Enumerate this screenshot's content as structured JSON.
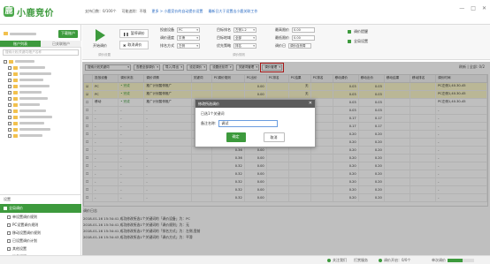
{
  "app": {
    "title": "小鹿竞价"
  },
  "header": {
    "meta_items": [
      "支持日数：0/100个",
      "可能追踪：不限"
    ],
    "links": [
      "更多 > 小鹿竞价的自动提价设置",
      "最新日大于设置出小鹿关联工作"
    ],
    "window_controls": [
      "—",
      "□",
      "✕"
    ]
  },
  "sidebar": {
    "download_button": "下载账户",
    "tabs": [
      "账户列表",
      "已关联账户"
    ],
    "search_placeholder": "搜索计划/关键词/账户名称",
    "tree_count": 13,
    "settings_title": "设置",
    "active_item": "全局调价",
    "items": [
      "单设置调价规则",
      "PC设置调价规则",
      "移动设置调价规则",
      "已设置调价计划",
      "其他设置",
      "消息提醒"
    ]
  },
  "toolbar": {
    "start_label": "开始调价",
    "pause_label": "暂停调价",
    "reset_label": "取消调价",
    "group_labels": [
      "调价设置",
      "调价规则"
    ],
    "fields_col1": [
      {
        "label": "投放设备",
        "value": "PC"
      },
      {
        "label": "调价速度",
        "value": "平滑"
      },
      {
        "label": "排名方式",
        "value": "左侧"
      }
    ],
    "fields_col2": [
      {
        "label": "目标排名",
        "value": "左侧1-2"
      },
      {
        "label": "目标地域",
        "value": "全部"
      },
      {
        "label": "优先策略",
        "value": "排名"
      }
    ],
    "fields_col3": [
      {
        "label": "最高限价",
        "value": "0.00"
      },
      {
        "label": "最低限价",
        "value": "0.00"
      },
      {
        "label": "调价日",
        "value": "调价自然周"
      }
    ],
    "right_buttons": [
      "调价提醒",
      "全局设置"
    ]
  },
  "filters": {
    "search_placeholder": "搜索计划关键词",
    "items": [
      "查看全部调价",
      "导入/导出",
      "设定调价",
      "设置优化项",
      "关键词管理",
      "调价管理"
    ],
    "highlighted": "调价管理",
    "refresh_label": "刷新 | 全部: 0/2"
  },
  "table": {
    "columns": [
      "",
      "投放设备",
      "调价状态",
      "调价详情",
      "关键词",
      "PC调价规则",
      "PC出价",
      "PC排名",
      "PC结果",
      "PC排名",
      "移动调价",
      "移动出价",
      "移动结果",
      "移动排名",
      "调价时间"
    ],
    "rows": [
      [
        "☑",
        "PC",
        "• 完成",
        "推广计划暂停推广",
        "",
        "",
        "0.00",
        "",
        "无",
        "",
        "0.03",
        "0.03",
        "",
        "",
        "PC左侧1,40.30-45"
      ],
      [
        "☑",
        "PC",
        "• 完成",
        "推广计划暂停推广",
        "",
        "",
        "0.00",
        "",
        "无",
        "",
        "0.03",
        "0.03",
        "",
        "",
        "PC左侧1,40.30-45"
      ],
      [
        "☐",
        "移动",
        "• 完成",
        "推广计划暂停推广",
        "",
        "",
        "0.00",
        "",
        "",
        "",
        "0.03",
        "0.03",
        "",
        "",
        "PC左侧1,40.30-45"
      ],
      [
        "☐",
        "-",
        "-",
        "-",
        "",
        "0.12",
        "0.00",
        "",
        "",
        "",
        "0.03",
        "0.03",
        "",
        "",
        "-"
      ],
      [
        "☐",
        "-",
        "-",
        "-",
        "",
        "0.12",
        "0.00",
        "",
        "",
        "",
        "0.17",
        "0.17",
        "",
        "",
        "-"
      ],
      [
        "☐",
        "-",
        "-",
        "-",
        "",
        "0.12",
        "0.00",
        "",
        "",
        "",
        "0.17",
        "0.17",
        "",
        "",
        "-"
      ],
      [
        "☐",
        "-",
        "-",
        "-",
        "",
        "0.32",
        "0.00",
        "",
        "",
        "",
        "0.20",
        "0.20",
        "",
        "",
        "-"
      ],
      [
        "☐",
        "-",
        "-",
        "-",
        "",
        "0.32",
        "0.00",
        "",
        "",
        "",
        "0.20",
        "0.20",
        "",
        "",
        "-"
      ],
      [
        "☐",
        "-",
        "-",
        "-",
        "",
        "0.36",
        "0.00",
        "",
        "",
        "",
        "0.20",
        "0.20",
        "",
        "",
        "-"
      ],
      [
        "☐",
        "-",
        "-",
        "-",
        "",
        "0.36",
        "0.00",
        "",
        "",
        "",
        "0.20",
        "0.20",
        "",
        "",
        "-"
      ],
      [
        "☐",
        "-",
        "-",
        "-",
        "",
        "0.32",
        "0.00",
        "",
        "",
        "",
        "0.20",
        "0.20",
        "",
        "",
        "-"
      ],
      [
        "☐",
        "-",
        "-",
        "-",
        "",
        "0.32",
        "0.00",
        "",
        "",
        "",
        "0.20",
        "0.20",
        "",
        "",
        "-"
      ],
      [
        "☐",
        "-",
        "-",
        "-",
        "",
        "0.32",
        "0.00",
        "",
        "",
        "",
        "0.20",
        "0.20",
        "",
        "",
        "-"
      ],
      [
        "☐",
        "-",
        "-",
        "-",
        "",
        "0.32",
        "0.00",
        "",
        "",
        "",
        "0.20",
        "0.20",
        "",
        "",
        "-"
      ],
      [
        "☐",
        "-",
        "-",
        "-",
        "",
        "0.32",
        "0.00",
        "",
        "",
        "",
        "0.20",
        "0.20",
        "",
        "",
        "-"
      ]
    ]
  },
  "log": {
    "title": "调价日志",
    "lines": [
      "2018-01-16 15:34:41 成功修改所选1个关键词的「调价设备」为：PC",
      "2018-01-16 15:34:41 成功修改所选1个关键词的「调价规则」为：无",
      "2018-01-16 15:34:41 成功修改所选1个关键词的「排名方式」为：左侧,靠前",
      "2018-01-16 15:34:43 成功修改所选1个关键词的「调价方式」为：平滑"
    ]
  },
  "status": {
    "left": "关注我们",
    "mid1": "打赏服务",
    "mid2": "调价开启：0/0个",
    "right": "单次调价",
    "progress": 0.55
  },
  "modal": {
    "title": "修改所选调价",
    "close": "✕",
    "info": "已选1个关键词",
    "field_label": "备注名称:",
    "field_value": "调试",
    "ok": "确定",
    "cancel": "取消"
  },
  "colors": {
    "brand": "#3d9a3d",
    "highlight": "#e02020",
    "row_selected": "#f8f4c8"
  }
}
